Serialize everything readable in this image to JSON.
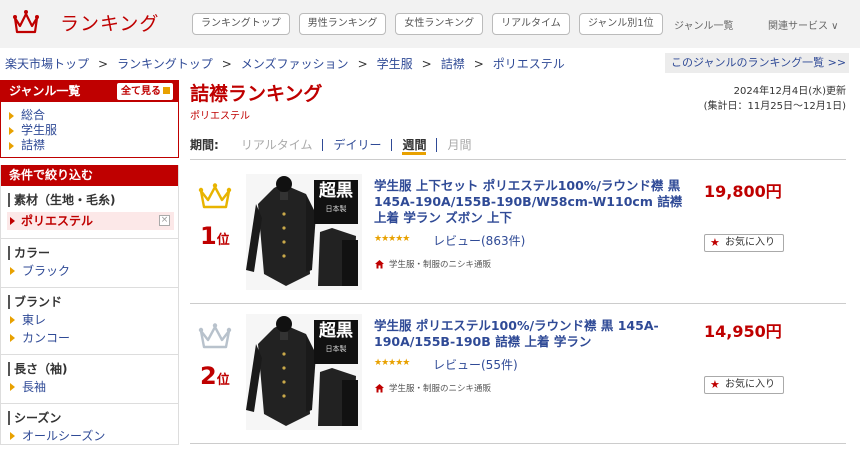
{
  "header": {
    "logo_text": "ランキング",
    "nav": [
      "ランキングトップ",
      "男性ランキング",
      "女性ランキング",
      "リアルタイム",
      "ジャンル別1位"
    ],
    "genre_list_link": "ジャンル一覧",
    "related_services": "関連サービス ∨"
  },
  "breadcrumb": [
    "楽天市場トップ",
    "ランキングトップ",
    "メンズファッション",
    "学生服",
    "詰襟",
    "ポリエステル"
  ],
  "breadcrumb_sep": ">",
  "genre_ranking_link": "このジャンルのランキング一覧 >>",
  "sidebar": {
    "genre_title": "ジャンル一覧",
    "see_all": "全て見る",
    "genres": [
      "総合",
      "学生服",
      "詰襟"
    ],
    "filter_title": "条件で絞り込む",
    "groups": [
      {
        "title": "素材（生地・毛糸)",
        "selected": "ポリエステル",
        "clear": "×",
        "items": []
      },
      {
        "title": "カラー",
        "items": [
          "ブラック"
        ]
      },
      {
        "title": "ブランド",
        "items": [
          "東レ",
          "カンコー"
        ]
      },
      {
        "title": "長さ（袖)",
        "items": [
          "長袖"
        ]
      },
      {
        "title": "シーズン",
        "items": [
          "オールシーズン"
        ]
      }
    ]
  },
  "main": {
    "title": "詰襟ランキング",
    "subtitle": "ポリエステル",
    "updated": "2024年12月4日(水)更新",
    "period_range": "(集計日：11月25日～12月1日)",
    "period_label": "期間:",
    "periods": [
      {
        "label": "リアルタイム",
        "state": "disabled"
      },
      {
        "label": "デイリー",
        "state": "link"
      },
      {
        "label": "週間",
        "state": "selected"
      },
      {
        "label": "月間",
        "state": "disabled"
      }
    ]
  },
  "items": [
    {
      "rank": "1",
      "rank_unit": "位",
      "crown_color": "#e8b400",
      "title": "学生服 上下セット ポリエステル100%/ラウンド襟 黒 145A-190A/155B-190B/W58cm-W110cm 詰襟 上着 学ラン ズボン 上下",
      "stars": "★★★★★",
      "rating": 4.5,
      "review": "レビュー(863件)",
      "shop": "学生服・制服のニシキ通販",
      "price": "19,800円",
      "favorite": "お気に入り",
      "thumb_badge": "超黒",
      "thumb_sub": "日本製"
    },
    {
      "rank": "2",
      "rank_unit": "位",
      "crown_color": "#b8c2cc",
      "title": "学生服 ポリエステル100%/ラウンド襟 黒 145A-190A/155B-190B 詰襟 上着 学ラン",
      "stars": "★★★★★",
      "rating": 4.5,
      "review": "レビュー(55件)",
      "shop": "学生服・制服のニシキ通販",
      "price": "14,950円",
      "favorite": "お気に入り",
      "thumb_badge": "超黒",
      "thumb_sub": "日本製"
    }
  ]
}
